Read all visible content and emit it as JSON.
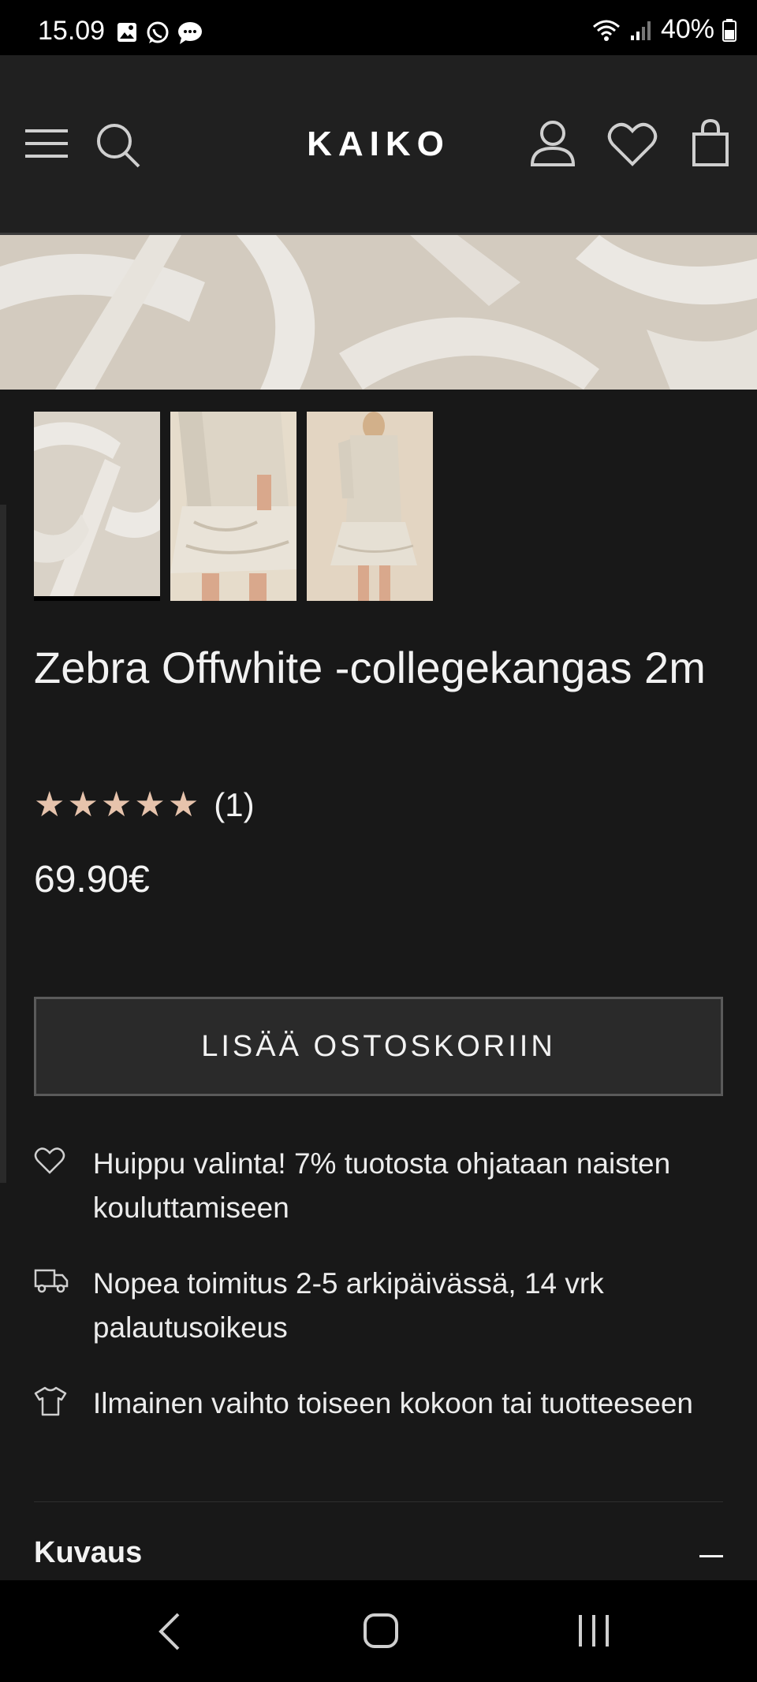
{
  "status_bar": {
    "time": "15.09",
    "battery": "40%",
    "notification_icons": [
      "gallery-icon",
      "whatsapp-icon",
      "messages-icon"
    ]
  },
  "header": {
    "logo": "KAIKO",
    "icons": [
      "menu-icon",
      "search-icon",
      "account-icon",
      "wishlist-icon",
      "cart-icon"
    ]
  },
  "product": {
    "title": "Zebra Offwhite -collegekangas 2m",
    "rating_stars": 5,
    "review_count": "(1)",
    "price": "69.90€",
    "add_to_cart_label": "LISÄÄ OSTOSKORIIN",
    "thumbnails": [
      "fabric",
      "dress-closeup",
      "dress-model"
    ]
  },
  "features": [
    {
      "icon": "heart-icon",
      "text": "Huippu valinta! 7% tuotosta ohjataan naisten kouluttamiseen"
    },
    {
      "icon": "truck-icon",
      "text": "Nopea toimitus 2-5 arkipäivässä, 14 vrk palautusoikeus"
    },
    {
      "icon": "tshirt-icon",
      "text": "Ilmainen vaihto toiseen kokoon tai tuotteeseen"
    }
  ],
  "accordion": {
    "label": "Kuvaus",
    "expanded": true
  },
  "colors": {
    "star": "#e6c3ac",
    "background": "#181818",
    "header": "#202020"
  },
  "nav_bar": [
    "back-icon",
    "home-icon",
    "recents-icon"
  ]
}
